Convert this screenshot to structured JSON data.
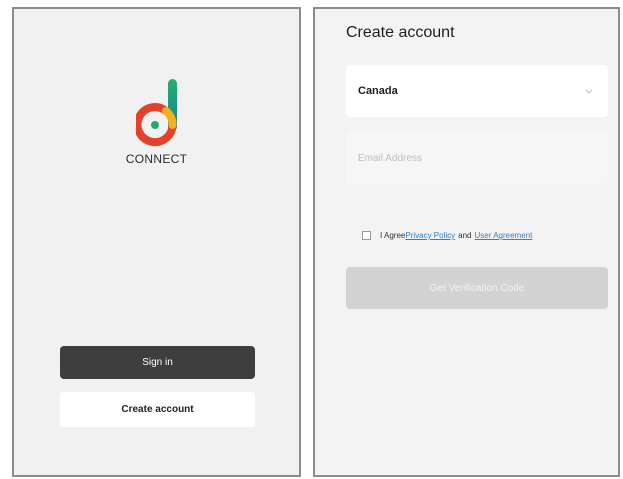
{
  "left_screen": {
    "brand_name": "CONNECT",
    "sign_in_label": "Sign in",
    "create_account_label": "Create account"
  },
  "right_screen": {
    "title": "Create account",
    "country_select": {
      "value": "Canada"
    },
    "email": {
      "placeholder": "Email Address",
      "value": ""
    },
    "agreement": {
      "prefix": "I Agree",
      "privacy_link": "Privacy Policy",
      "conjunction": "and",
      "user_agreement_link": "User Agreement"
    },
    "get_code_label": "Get Verification Code"
  },
  "colors": {
    "logo_red": "#e2412b",
    "logo_yellow": "#f2b022",
    "logo_green": "#21a86c",
    "logo_teal": "#1d8f9a",
    "primary_button": "#3e3e3e",
    "disabled_button": "#d3d3d3",
    "link": "#2f7fd1"
  },
  "icons": [
    "connect-logo-icon",
    "chevron-down-icon",
    "checkbox-icon"
  ]
}
